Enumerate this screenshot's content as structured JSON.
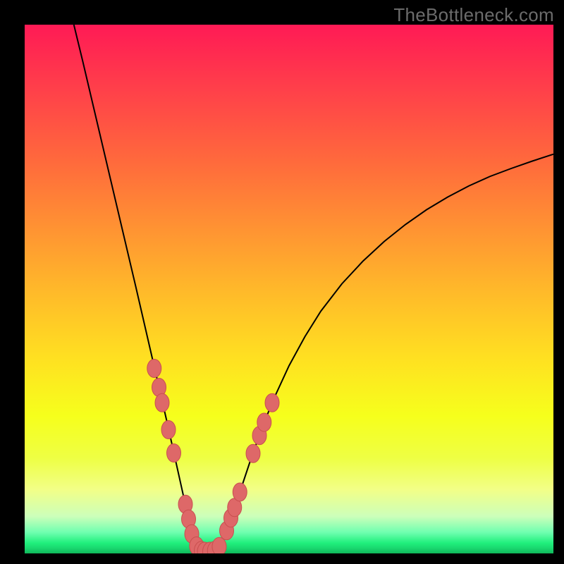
{
  "watermark": "TheBottleneck.com",
  "chart_data": {
    "type": "line",
    "title": "",
    "xlabel": "",
    "ylabel": "",
    "xlim": [
      0,
      100
    ],
    "ylim": [
      0,
      100
    ],
    "grid": false,
    "curve": [
      {
        "x": 9.3,
        "y": 100.0
      },
      {
        "x": 11.0,
        "y": 93.0
      },
      {
        "x": 13.0,
        "y": 84.5
      },
      {
        "x": 15.0,
        "y": 76.0
      },
      {
        "x": 17.0,
        "y": 67.5
      },
      {
        "x": 19.0,
        "y": 59.0
      },
      {
        "x": 21.0,
        "y": 50.5
      },
      {
        "x": 22.5,
        "y": 44.0
      },
      {
        "x": 24.0,
        "y": 37.5
      },
      {
        "x": 25.5,
        "y": 31.0
      },
      {
        "x": 27.0,
        "y": 24.5
      },
      {
        "x": 28.0,
        "y": 20.0
      },
      {
        "x": 29.0,
        "y": 15.5
      },
      {
        "x": 30.0,
        "y": 11.0
      },
      {
        "x": 30.7,
        "y": 7.5
      },
      {
        "x": 31.5,
        "y": 4.0
      },
      {
        "x": 32.3,
        "y": 1.7
      },
      {
        "x": 33.0,
        "y": 0.8
      },
      {
        "x": 34.0,
        "y": 0.4
      },
      {
        "x": 35.0,
        "y": 0.4
      },
      {
        "x": 36.0,
        "y": 0.6
      },
      {
        "x": 37.0,
        "y": 1.5
      },
      {
        "x": 38.0,
        "y": 3.5
      },
      {
        "x": 39.0,
        "y": 6.5
      },
      {
        "x": 40.0,
        "y": 9.5
      },
      {
        "x": 41.5,
        "y": 14.0
      },
      {
        "x": 43.0,
        "y": 18.5
      },
      {
        "x": 45.0,
        "y": 24.0
      },
      {
        "x": 47.0,
        "y": 29.0
      },
      {
        "x": 50.0,
        "y": 35.5
      },
      {
        "x": 53.0,
        "y": 41.0
      },
      {
        "x": 56.0,
        "y": 45.8
      },
      {
        "x": 60.0,
        "y": 51.0
      },
      {
        "x": 64.0,
        "y": 55.3
      },
      {
        "x": 68.0,
        "y": 59.0
      },
      {
        "x": 72.0,
        "y": 62.2
      },
      {
        "x": 76.0,
        "y": 65.0
      },
      {
        "x": 80.0,
        "y": 67.4
      },
      {
        "x": 84.0,
        "y": 69.5
      },
      {
        "x": 88.0,
        "y": 71.3
      },
      {
        "x": 92.0,
        "y": 72.8
      },
      {
        "x": 96.0,
        "y": 74.2
      },
      {
        "x": 100.0,
        "y": 75.5
      }
    ],
    "markers": [
      {
        "x": 24.5,
        "y": 35.0
      },
      {
        "x": 25.4,
        "y": 31.4
      },
      {
        "x": 26.0,
        "y": 28.5
      },
      {
        "x": 27.2,
        "y": 23.4
      },
      {
        "x": 28.2,
        "y": 19.0
      },
      {
        "x": 30.4,
        "y": 9.3
      },
      {
        "x": 31.0,
        "y": 6.5
      },
      {
        "x": 31.6,
        "y": 3.7
      },
      {
        "x": 32.5,
        "y": 1.4
      },
      {
        "x": 33.4,
        "y": 0.55
      },
      {
        "x": 34.0,
        "y": 0.4
      },
      {
        "x": 35.0,
        "y": 0.4
      },
      {
        "x": 35.9,
        "y": 0.55
      },
      {
        "x": 36.8,
        "y": 1.3
      },
      {
        "x": 38.2,
        "y": 4.3
      },
      {
        "x": 39.0,
        "y": 6.7
      },
      {
        "x": 39.7,
        "y": 8.7
      },
      {
        "x": 40.7,
        "y": 11.6
      },
      {
        "x": 43.2,
        "y": 18.9
      },
      {
        "x": 44.4,
        "y": 22.3
      },
      {
        "x": 45.3,
        "y": 24.8
      },
      {
        "x": 46.8,
        "y": 28.5
      }
    ]
  }
}
